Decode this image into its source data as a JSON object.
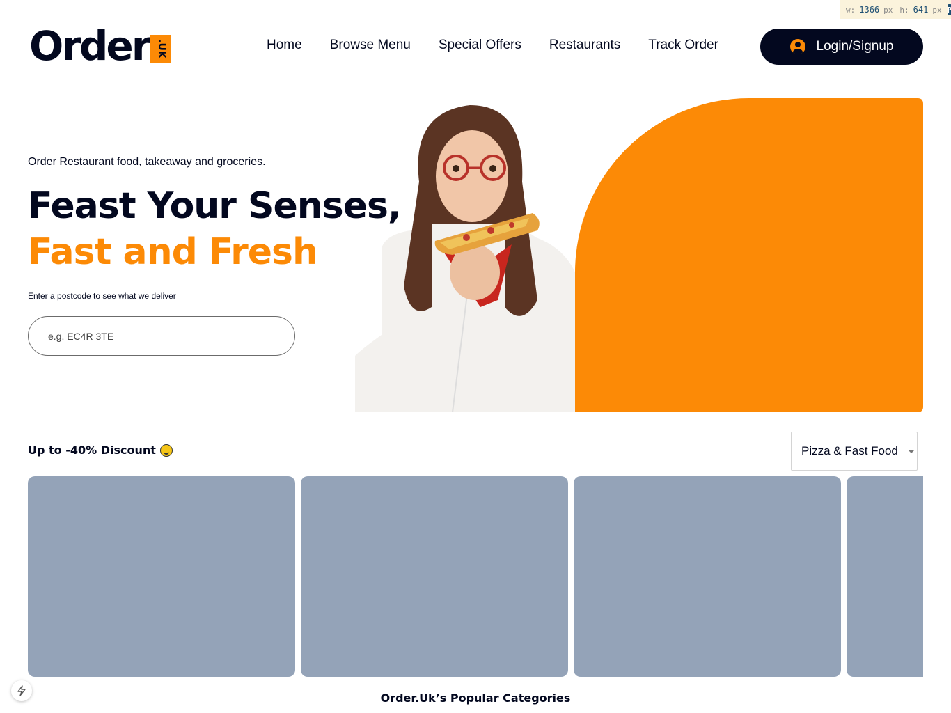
{
  "dev_overlay": {
    "width_label": "w:",
    "width_value": "1366",
    "height_label": "h:",
    "height_value": "641",
    "unit": "px",
    "badge": "P"
  },
  "brand": {
    "name": "Order",
    "badge_text": ".UK",
    "accent_color": "#fc8a06",
    "dark_color": "#03081f"
  },
  "nav": {
    "items": [
      {
        "label": "Home"
      },
      {
        "label": "Browse Menu"
      },
      {
        "label": "Special Offers"
      },
      {
        "label": "Restaurants"
      },
      {
        "label": "Track Order"
      }
    ],
    "login_label": "Login/Signup",
    "login_icon": "user-circle-icon"
  },
  "hero": {
    "tagline": "Order Restaurant food, takeaway and groceries.",
    "title_line1": "Feast Your Senses,",
    "title_line2": "Fast and Fresh",
    "postcode_label": "Enter a postcode to see what we deliver",
    "postcode_placeholder": "e.g. EC4R 3TE",
    "image": "woman-eating-pizza-photo"
  },
  "discount": {
    "title": "Up to -40% Discount",
    "title_icon": "smiley-icon",
    "category_selected": "Pizza & Fast Food",
    "card_color": "#94a3b8",
    "cards": [
      {
        "name": "deal-card-1"
      },
      {
        "name": "deal-card-2"
      },
      {
        "name": "deal-card-3"
      },
      {
        "name": "deal-card-4"
      }
    ]
  },
  "popular": {
    "title": "Order.Uk’s Popular Categories"
  },
  "dev_tools": {
    "icon": "lightning-bolt-icon"
  }
}
